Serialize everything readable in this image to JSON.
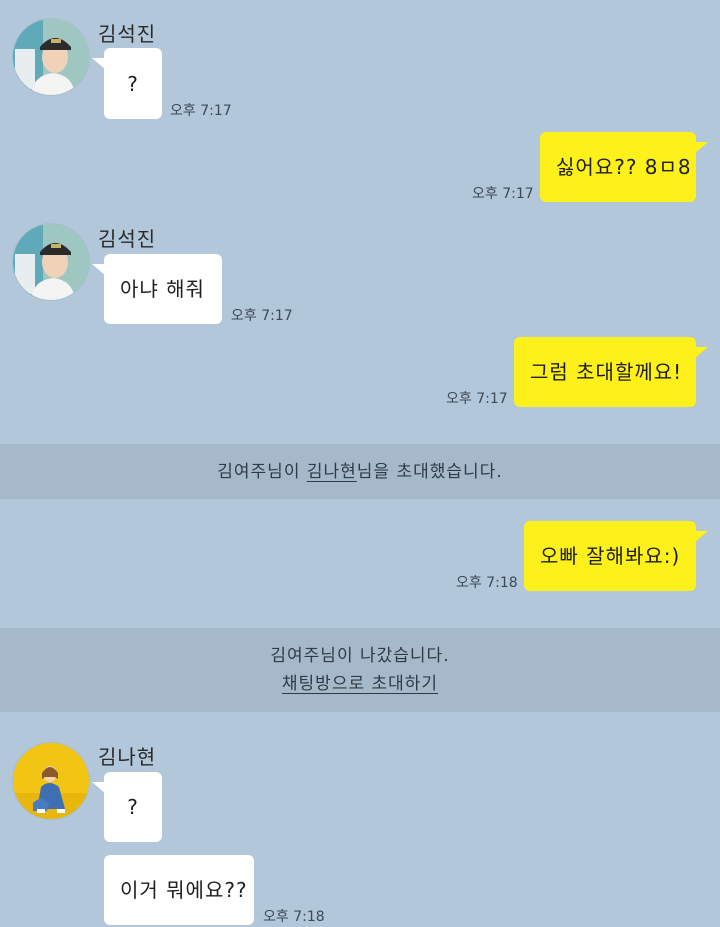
{
  "messages": {
    "m1": {
      "sender": "김석진",
      "text": "?",
      "time": "오후 7:17"
    },
    "m2": {
      "text": "싫어요?? 8ㅁ8",
      "time": "오후 7:17"
    },
    "m3": {
      "sender": "김석진",
      "text": "아냐 해줘",
      "time": "오후 7:17"
    },
    "m4": {
      "text": "그럼 초대할께요!",
      "time": "오후 7:17"
    },
    "m5": {
      "text": "오빠 잘해봐요:)",
      "time": "오후 7:18"
    },
    "m6": {
      "sender": "김나현",
      "text1": "?",
      "text2": "이거 뭐에요??",
      "time": "오후 7:18"
    }
  },
  "notices": {
    "invite": {
      "pre": "김여주님이 ",
      "link": "김나현",
      "post": "님을 초대했습니다."
    },
    "left": {
      "text": "김여주님이 나갔습니다.",
      "link": "채팅방으로 초대하기"
    }
  },
  "colors": {
    "background": "#b2c7d9",
    "my_bubble": "#fef01b",
    "other_bubble": "#ffffff",
    "notice_band": "#a5b9cb"
  }
}
